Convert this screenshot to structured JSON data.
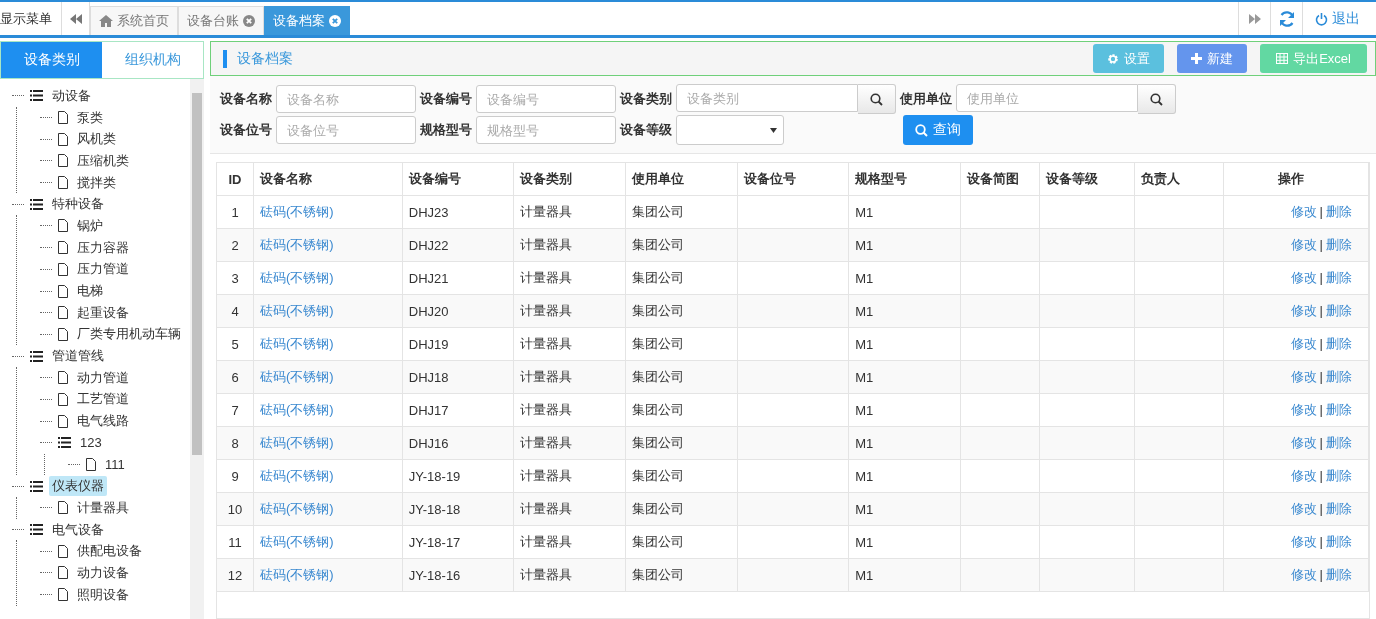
{
  "top_bar": {
    "menu_toggle": "显示菜单",
    "tabs": [
      {
        "label": "系统首页",
        "kind": "home",
        "closable": false,
        "selected": false
      },
      {
        "label": "设备台账",
        "kind": "page",
        "closable": true,
        "selected": false
      },
      {
        "label": "设备档案",
        "kind": "page",
        "closable": true,
        "selected": true
      }
    ],
    "logout": "退出"
  },
  "sidebar": {
    "tabs": [
      {
        "label": "设备类别",
        "selected": true
      },
      {
        "label": "组织机构",
        "selected": false
      }
    ],
    "tree": [
      {
        "label": "动设备",
        "selected": false,
        "children": [
          {
            "label": "泵类",
            "selected": false
          },
          {
            "label": "风机类",
            "selected": false
          },
          {
            "label": "压缩机类",
            "selected": false
          },
          {
            "label": "搅拌类",
            "selected": false
          }
        ]
      },
      {
        "label": "特种设备",
        "selected": false,
        "children": [
          {
            "label": "锅炉",
            "selected": false
          },
          {
            "label": "压力容器",
            "selected": false
          },
          {
            "label": "压力管道",
            "selected": false
          },
          {
            "label": "电梯",
            "selected": false
          },
          {
            "label": "起重设备",
            "selected": false
          },
          {
            "label": "厂类专用机动车辆",
            "selected": false
          }
        ]
      },
      {
        "label": "管道管线",
        "selected": false,
        "children": [
          {
            "label": "动力管道",
            "selected": false
          },
          {
            "label": "工艺管道",
            "selected": false
          },
          {
            "label": "电气线路",
            "selected": false
          },
          {
            "label": "123",
            "selected": false,
            "children": [
              {
                "label": "111",
                "selected": false
              }
            ]
          }
        ]
      },
      {
        "label": "仪表仪器",
        "selected": true,
        "children": [
          {
            "label": "计量器具",
            "selected": false
          }
        ]
      },
      {
        "label": "电气设备",
        "selected": false,
        "children": [
          {
            "label": "供配电设备",
            "selected": false
          },
          {
            "label": "动力设备",
            "selected": false
          },
          {
            "label": "照明设备",
            "selected": false
          }
        ]
      }
    ]
  },
  "panel": {
    "title": "设备档案",
    "buttons": [
      {
        "label": "设置",
        "kind": "settings"
      },
      {
        "label": "新建",
        "kind": "new"
      },
      {
        "label": "导出Excel",
        "kind": "export"
      }
    ]
  },
  "filters": [
    {
      "label": "设备名称",
      "placeholder": "设备名称",
      "kind": "text"
    },
    {
      "label": "设备编号",
      "placeholder": "设备编号",
      "kind": "text"
    },
    {
      "label": "设备类别",
      "placeholder": "设备类别",
      "kind": "lookup"
    },
    {
      "label": "使用单位",
      "placeholder": "使用单位",
      "kind": "lookup"
    },
    {
      "label": "设备位号",
      "placeholder": "设备位号",
      "kind": "text"
    },
    {
      "label": "规格型号",
      "placeholder": "规格型号",
      "kind": "text"
    },
    {
      "label": "设备等级",
      "kind": "select"
    }
  ],
  "search_button": "查询",
  "table": {
    "columns": [
      "ID",
      "设备名称",
      "设备编号",
      "设备类别",
      "使用单位",
      "设备位号",
      "规格型号",
      "设备简图",
      "设备等级",
      "负责人",
      "操作"
    ],
    "rows": [
      {
        "cells": [
          "1",
          "砝码(不锈钢)",
          "DHJ23",
          "计量器具",
          "集团公司",
          "",
          "M1",
          "",
          "",
          ""
        ],
        "edit": "修改",
        "separator": "|",
        "delete": "删除"
      },
      {
        "cells": [
          "2",
          "砝码(不锈钢)",
          "DHJ22",
          "计量器具",
          "集团公司",
          "",
          "M1",
          "",
          "",
          ""
        ],
        "edit": "修改",
        "separator": "|",
        "delete": "删除"
      },
      {
        "cells": [
          "3",
          "砝码(不锈钢)",
          "DHJ21",
          "计量器具",
          "集团公司",
          "",
          "M1",
          "",
          "",
          ""
        ],
        "edit": "修改",
        "separator": "|",
        "delete": "删除"
      },
      {
        "cells": [
          "4",
          "砝码(不锈钢)",
          "DHJ20",
          "计量器具",
          "集团公司",
          "",
          "M1",
          "",
          "",
          ""
        ],
        "edit": "修改",
        "separator": "|",
        "delete": "删除"
      },
      {
        "cells": [
          "5",
          "砝码(不锈钢)",
          "DHJ19",
          "计量器具",
          "集团公司",
          "",
          "M1",
          "",
          "",
          ""
        ],
        "edit": "修改",
        "separator": "|",
        "delete": "删除"
      },
      {
        "cells": [
          "6",
          "砝码(不锈钢)",
          "DHJ18",
          "计量器具",
          "集团公司",
          "",
          "M1",
          "",
          "",
          ""
        ],
        "edit": "修改",
        "separator": "|",
        "delete": "删除"
      },
      {
        "cells": [
          "7",
          "砝码(不锈钢)",
          "DHJ17",
          "计量器具",
          "集团公司",
          "",
          "M1",
          "",
          "",
          ""
        ],
        "edit": "修改",
        "separator": "|",
        "delete": "删除"
      },
      {
        "cells": [
          "8",
          "砝码(不锈钢)",
          "DHJ16",
          "计量器具",
          "集团公司",
          "",
          "M1",
          "",
          "",
          ""
        ],
        "edit": "修改",
        "separator": "|",
        "delete": "删除"
      },
      {
        "cells": [
          "9",
          "砝码(不锈钢)",
          "JY-18-19",
          "计量器具",
          "集团公司",
          "",
          "M1",
          "",
          "",
          ""
        ],
        "edit": "修改",
        "separator": "|",
        "delete": "删除"
      },
      {
        "cells": [
          "10",
          "砝码(不锈钢)",
          "JY-18-18",
          "计量器具",
          "集团公司",
          "",
          "M1",
          "",
          "",
          ""
        ],
        "edit": "修改",
        "separator": "|",
        "delete": "删除"
      },
      {
        "cells": [
          "11",
          "砝码(不锈钢)",
          "JY-18-17",
          "计量器具",
          "集团公司",
          "",
          "M1",
          "",
          "",
          ""
        ],
        "edit": "修改",
        "separator": "|",
        "delete": "删除"
      },
      {
        "cells": [
          "12",
          "砝码(不锈钢)",
          "JY-18-16",
          "计量器具",
          "集团公司",
          "",
          "M1",
          "",
          "",
          ""
        ],
        "edit": "修改",
        "separator": "|",
        "delete": "删除"
      }
    ]
  }
}
